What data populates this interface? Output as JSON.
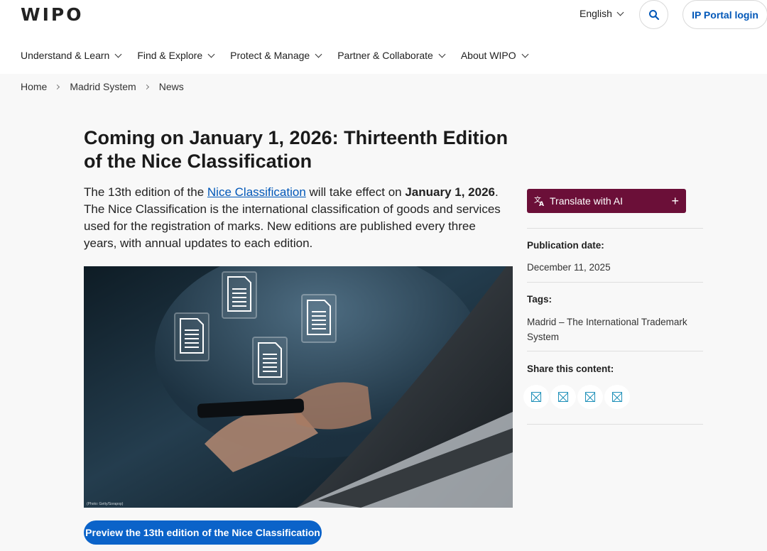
{
  "header": {
    "logo": "WIPO",
    "language": "English",
    "portal_login": "IP Portal login",
    "search_icon": "search-icon"
  },
  "nav": {
    "items": [
      {
        "label": "Understand & Learn"
      },
      {
        "label": "Find & Explore"
      },
      {
        "label": "Protect & Manage"
      },
      {
        "label": "Partner & Collaborate"
      },
      {
        "label": "About WIPO"
      }
    ]
  },
  "breadcrumb": [
    "Home",
    "Madrid System",
    "News"
  ],
  "article": {
    "title": "Coming on January 1, 2026: Thirteenth Edition of the Nice Classification",
    "lead_prefix": "The 13th edition of the ",
    "lead_link": "Nice Classification",
    "lead_middle": " will take effect on ",
    "lead_date": "January 1, 2026",
    "lead_suffix": ". The Nice Classification is the international classification of goods and services used for the registration of marks. New editions are published every three years, with annual updates to each edition.",
    "image_credit": "(Photo: Getty/Sorapop)",
    "preview_button": "Preview the 13th edition of the Nice Classification"
  },
  "sidebar": {
    "translate_label": "Translate with AI",
    "translate_plus": "+",
    "publication_label": "Publication date:",
    "publication_value": "December 11, 2025",
    "tags_label": "Tags:",
    "tags_value": "Madrid – The International Trademark System",
    "share_label": "Share this content:",
    "share_icons": [
      "share-icon-1",
      "share-icon-2",
      "share-icon-3",
      "share-icon-4"
    ]
  },
  "colors": {
    "brand_blue": "#0057b8",
    "button_blue": "#0b63c9",
    "translate_bg": "#6b0f38",
    "share_icon": "#1c8fb8"
  }
}
